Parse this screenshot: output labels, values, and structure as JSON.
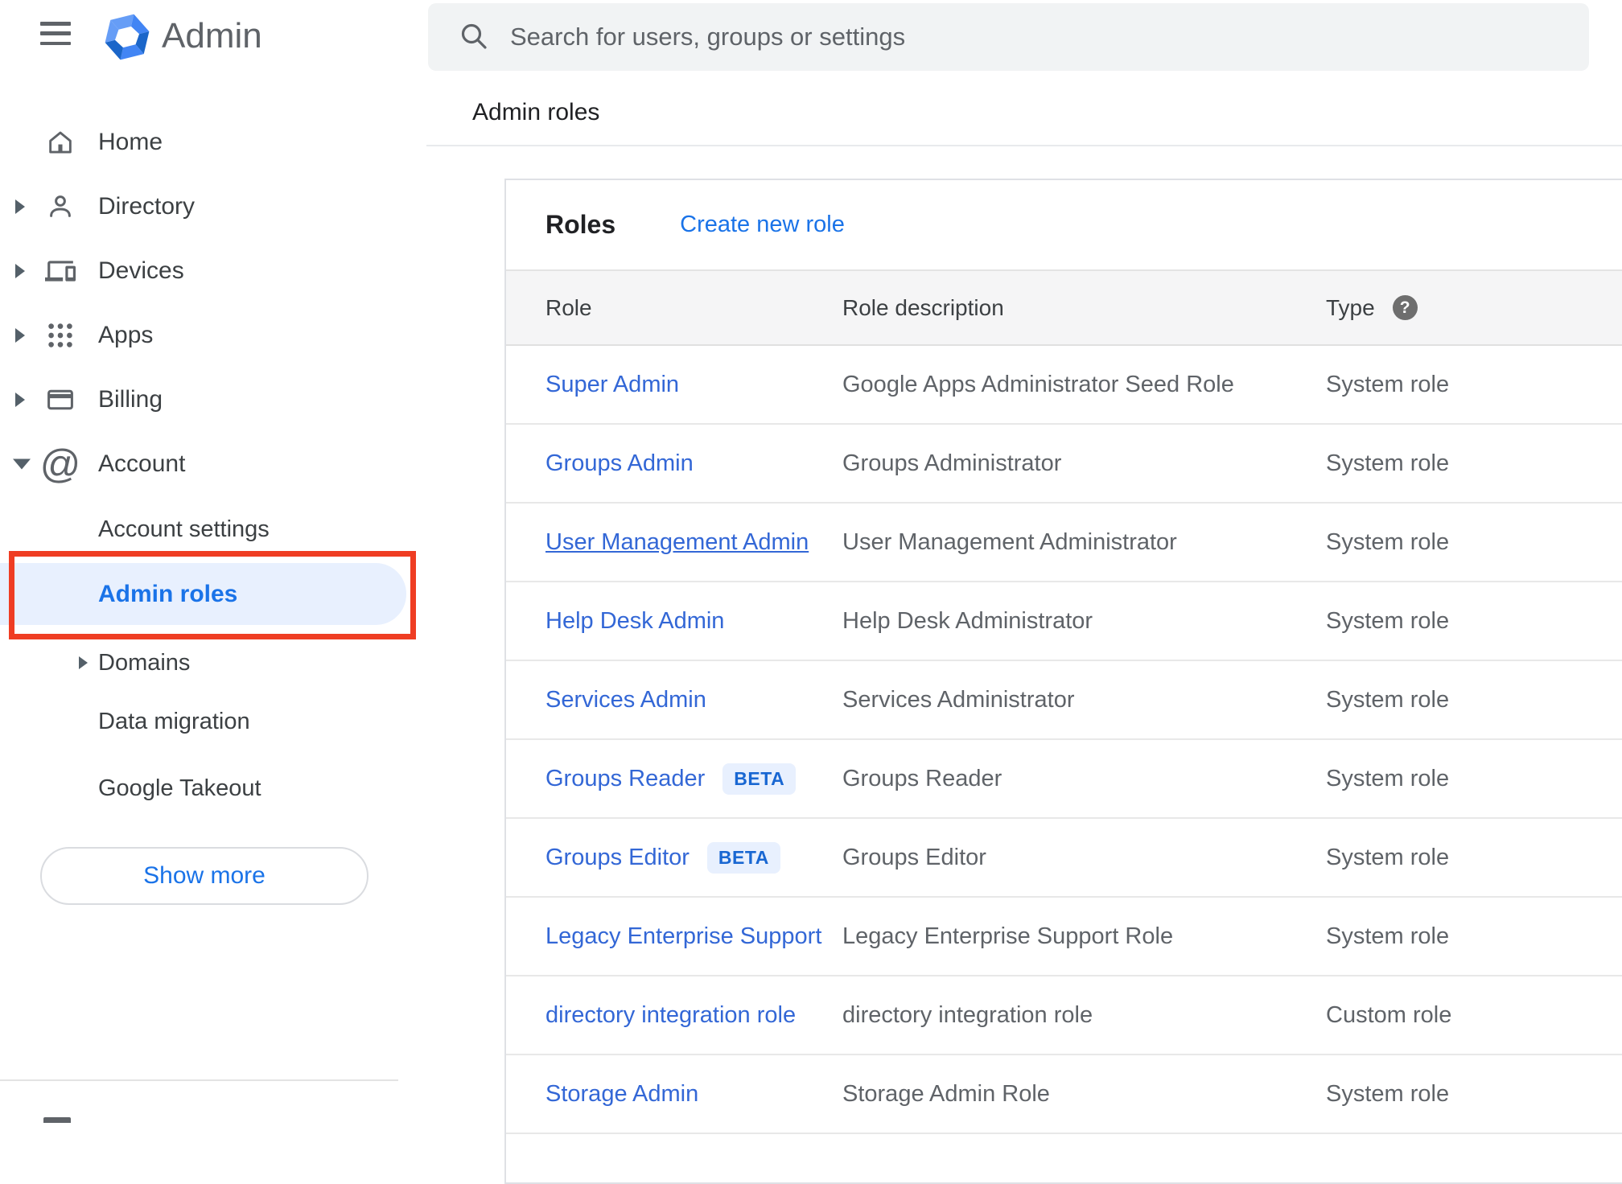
{
  "app": {
    "title": "Admin"
  },
  "search": {
    "placeholder": "Search for users, groups or settings"
  },
  "breadcrumb": "Admin roles",
  "sidebar": {
    "items": [
      {
        "label": "Home"
      },
      {
        "label": "Directory"
      },
      {
        "label": "Devices"
      },
      {
        "label": "Apps"
      },
      {
        "label": "Billing"
      },
      {
        "label": "Account"
      },
      {
        "label": "Account settings"
      },
      {
        "label": "Admin roles"
      },
      {
        "label": "Domains"
      },
      {
        "label": "Data migration"
      },
      {
        "label": "Google Takeout"
      }
    ],
    "show_more_label": "Show more"
  },
  "roles_panel": {
    "title": "Roles",
    "create_link": "Create new role",
    "columns": {
      "role": "Role",
      "description": "Role description",
      "type": "Type"
    },
    "beta_label": "BETA",
    "rows": [
      {
        "role": "Super Admin",
        "description": "Google Apps Administrator Seed Role",
        "type": "System role"
      },
      {
        "role": "Groups Admin",
        "description": "Groups Administrator",
        "type": "System role"
      },
      {
        "role": "User Management Admin",
        "description": "User Management Administrator",
        "type": "System role",
        "hover_underline": true
      },
      {
        "role": "Help Desk Admin",
        "description": "Help Desk Administrator",
        "type": "System role"
      },
      {
        "role": "Services Admin",
        "description": "Services Administrator",
        "type": "System role"
      },
      {
        "role": "Groups Reader",
        "description": "Groups Reader",
        "type": "System role",
        "beta": true
      },
      {
        "role": "Groups Editor",
        "description": "Groups Editor",
        "type": "System role",
        "beta": true
      },
      {
        "role": "Legacy Enterprise Support",
        "description": "Legacy Enterprise Support Role",
        "type": "System role"
      },
      {
        "role": "directory integration role",
        "description": "directory integration role",
        "type": "Custom role"
      },
      {
        "role": "Storage Admin",
        "description": "Storage Admin Role",
        "type": "System role"
      }
    ]
  },
  "colors": {
    "accent_blue": "#1a73e8",
    "table_link_blue": "#3367d6",
    "active_item_bg": "#e8f0fe",
    "annotation_red": "#ef3d23",
    "beta_bg": "#e8f0fe",
    "beta_text": "#1967d2",
    "header_band_bg": "#f5f5f6",
    "icon_gray": "#5f6368",
    "logo_blue": "#4285f4"
  }
}
